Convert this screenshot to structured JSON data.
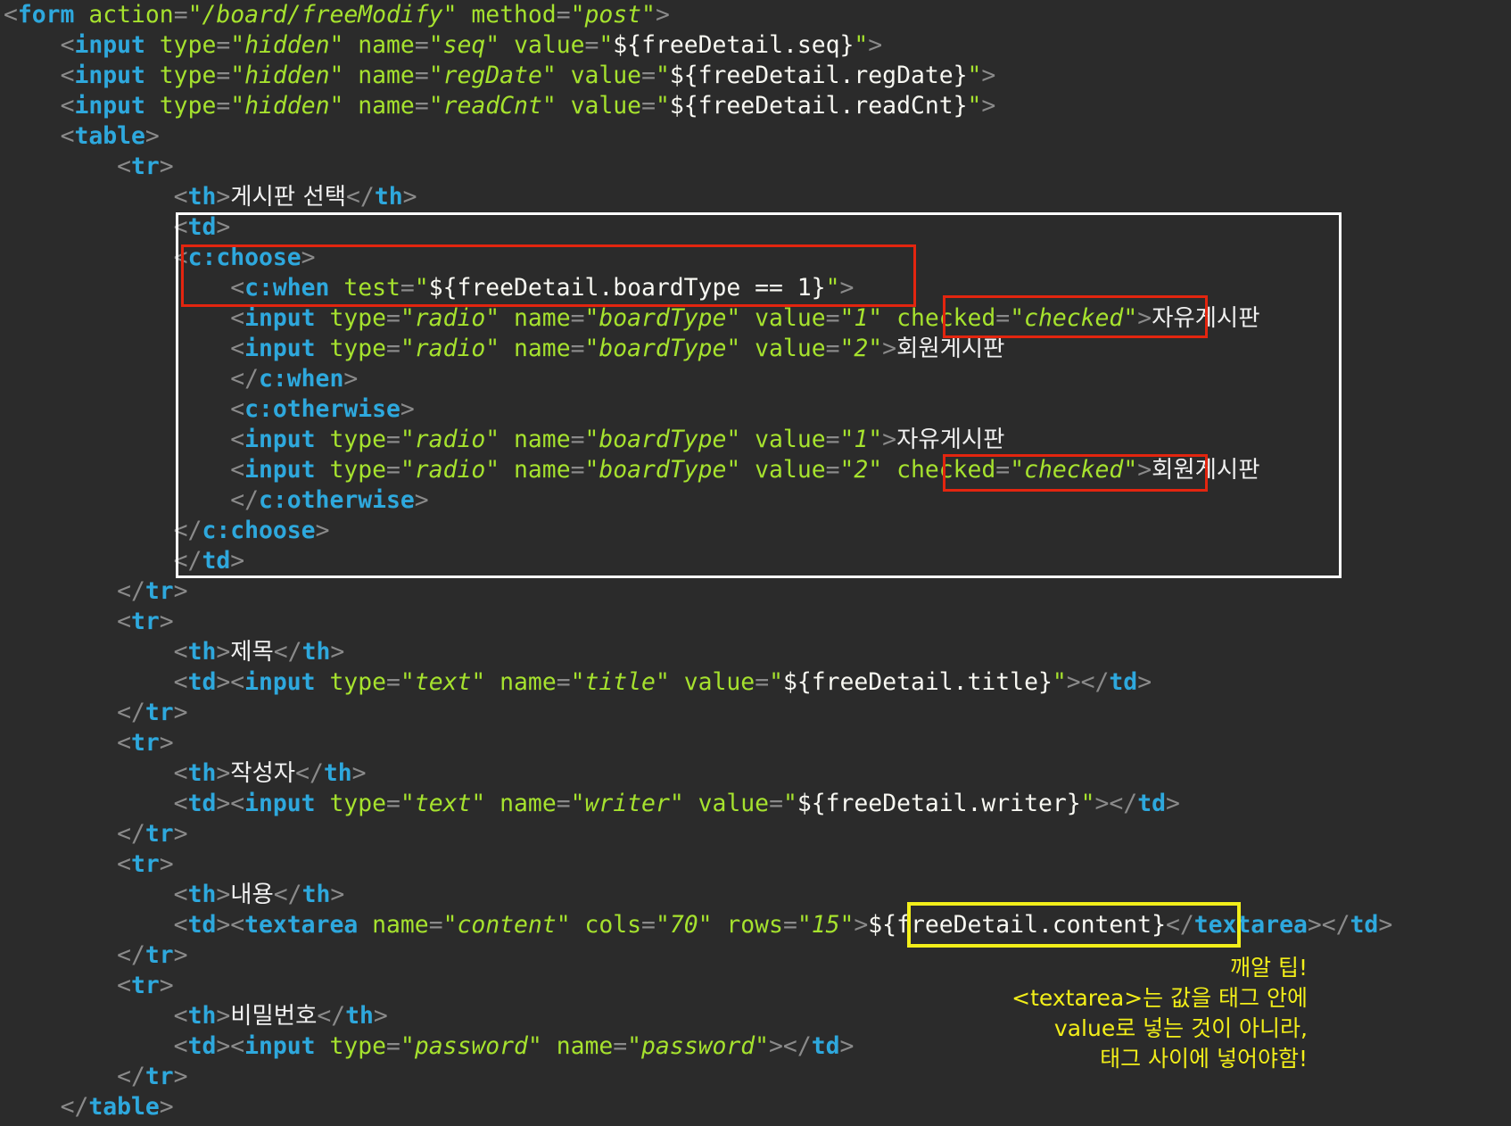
{
  "code_lines": [
    [
      [
        "pun",
        "<"
      ],
      [
        "tag",
        "form"
      ],
      [
        "sp",
        " "
      ],
      [
        "attr",
        "action"
      ],
      [
        "pun",
        "="
      ],
      [
        "q",
        "\""
      ],
      [
        "str",
        "/board/freeModify"
      ],
      [
        "q",
        "\""
      ],
      [
        "sp",
        " "
      ],
      [
        "attr",
        "method"
      ],
      [
        "pun",
        "="
      ],
      [
        "q",
        "\""
      ],
      [
        "str",
        "post"
      ],
      [
        "q",
        "\""
      ],
      [
        "pun",
        ">"
      ]
    ],
    [
      [
        "sp",
        "    "
      ],
      [
        "pun",
        "<"
      ],
      [
        "tag",
        "input"
      ],
      [
        "sp",
        " "
      ],
      [
        "attr",
        "type"
      ],
      [
        "pun",
        "="
      ],
      [
        "q",
        "\""
      ],
      [
        "str",
        "hidden"
      ],
      [
        "q",
        "\""
      ],
      [
        "sp",
        " "
      ],
      [
        "attr",
        "name"
      ],
      [
        "pun",
        "="
      ],
      [
        "q",
        "\""
      ],
      [
        "str",
        "seq"
      ],
      [
        "q",
        "\""
      ],
      [
        "sp",
        " "
      ],
      [
        "attr",
        "value"
      ],
      [
        "pun",
        "="
      ],
      [
        "q",
        "\""
      ],
      [
        "el",
        "${freeDetail.seq}"
      ],
      [
        "q",
        "\""
      ],
      [
        "pun",
        ">"
      ]
    ],
    [
      [
        "sp",
        "    "
      ],
      [
        "pun",
        "<"
      ],
      [
        "tag",
        "input"
      ],
      [
        "sp",
        " "
      ],
      [
        "attr",
        "type"
      ],
      [
        "pun",
        "="
      ],
      [
        "q",
        "\""
      ],
      [
        "str",
        "hidden"
      ],
      [
        "q",
        "\""
      ],
      [
        "sp",
        " "
      ],
      [
        "attr",
        "name"
      ],
      [
        "pun",
        "="
      ],
      [
        "q",
        "\""
      ],
      [
        "str",
        "regDate"
      ],
      [
        "q",
        "\""
      ],
      [
        "sp",
        " "
      ],
      [
        "attr",
        "value"
      ],
      [
        "pun",
        "="
      ],
      [
        "q",
        "\""
      ],
      [
        "el",
        "${freeDetail.regDate}"
      ],
      [
        "q",
        "\""
      ],
      [
        "pun",
        ">"
      ]
    ],
    [
      [
        "sp",
        "    "
      ],
      [
        "pun",
        "<"
      ],
      [
        "tag",
        "input"
      ],
      [
        "sp",
        " "
      ],
      [
        "attr",
        "type"
      ],
      [
        "pun",
        "="
      ],
      [
        "q",
        "\""
      ],
      [
        "str",
        "hidden"
      ],
      [
        "q",
        "\""
      ],
      [
        "sp",
        " "
      ],
      [
        "attr",
        "name"
      ],
      [
        "pun",
        "="
      ],
      [
        "q",
        "\""
      ],
      [
        "str",
        "readCnt"
      ],
      [
        "q",
        "\""
      ],
      [
        "sp",
        " "
      ],
      [
        "attr",
        "value"
      ],
      [
        "pun",
        "="
      ],
      [
        "q",
        "\""
      ],
      [
        "el",
        "${freeDetail.readCnt}"
      ],
      [
        "q",
        "\""
      ],
      [
        "pun",
        ">"
      ]
    ],
    [
      [
        "sp",
        "    "
      ],
      [
        "pun",
        "<"
      ],
      [
        "tag",
        "table"
      ],
      [
        "pun",
        ">"
      ]
    ],
    [
      [
        "sp",
        "        "
      ],
      [
        "pun",
        "<"
      ],
      [
        "tag",
        "tr"
      ],
      [
        "pun",
        ">"
      ]
    ],
    [
      [
        "sp",
        "            "
      ],
      [
        "pun",
        "<"
      ],
      [
        "tag",
        "th"
      ],
      [
        "pun",
        ">"
      ],
      [
        "ko",
        "게시판 선택"
      ],
      [
        "pun",
        "</"
      ],
      [
        "tag",
        "th"
      ],
      [
        "pun",
        ">"
      ]
    ],
    [
      [
        "sp",
        "            "
      ],
      [
        "pun",
        "<"
      ],
      [
        "tag",
        "td"
      ],
      [
        "pun",
        ">"
      ]
    ],
    [
      [
        "sp",
        "            "
      ],
      [
        "pun",
        "<"
      ],
      [
        "tag",
        "c:choose"
      ],
      [
        "pun",
        ">"
      ]
    ],
    [
      [
        "sp",
        "                "
      ],
      [
        "pun",
        "<"
      ],
      [
        "tag",
        "c:when"
      ],
      [
        "sp",
        " "
      ],
      [
        "attr",
        "test"
      ],
      [
        "pun",
        "="
      ],
      [
        "q",
        "\""
      ],
      [
        "el",
        "${freeDetail.boardType == 1}"
      ],
      [
        "q",
        "\""
      ],
      [
        "pun",
        ">"
      ]
    ],
    [
      [
        "sp",
        "                "
      ],
      [
        "pun",
        "<"
      ],
      [
        "tag",
        "input"
      ],
      [
        "sp",
        " "
      ],
      [
        "attr",
        "type"
      ],
      [
        "pun",
        "="
      ],
      [
        "q",
        "\""
      ],
      [
        "str",
        "radio"
      ],
      [
        "q",
        "\""
      ],
      [
        "sp",
        " "
      ],
      [
        "attr",
        "name"
      ],
      [
        "pun",
        "="
      ],
      [
        "q",
        "\""
      ],
      [
        "str",
        "boardType"
      ],
      [
        "q",
        "\""
      ],
      [
        "sp",
        " "
      ],
      [
        "attr",
        "value"
      ],
      [
        "pun",
        "="
      ],
      [
        "q",
        "\""
      ],
      [
        "str",
        "1"
      ],
      [
        "q",
        "\""
      ],
      [
        "sp",
        " "
      ],
      [
        "attr",
        "checked"
      ],
      [
        "pun",
        "="
      ],
      [
        "q",
        "\""
      ],
      [
        "str",
        "checked"
      ],
      [
        "q",
        "\""
      ],
      [
        "pun",
        ">"
      ],
      [
        "ko",
        "자유게시판"
      ]
    ],
    [
      [
        "sp",
        "                "
      ],
      [
        "pun",
        "<"
      ],
      [
        "tag",
        "input"
      ],
      [
        "sp",
        " "
      ],
      [
        "attr",
        "type"
      ],
      [
        "pun",
        "="
      ],
      [
        "q",
        "\""
      ],
      [
        "str",
        "radio"
      ],
      [
        "q",
        "\""
      ],
      [
        "sp",
        " "
      ],
      [
        "attr",
        "name"
      ],
      [
        "pun",
        "="
      ],
      [
        "q",
        "\""
      ],
      [
        "str",
        "boardType"
      ],
      [
        "q",
        "\""
      ],
      [
        "sp",
        " "
      ],
      [
        "attr",
        "value"
      ],
      [
        "pun",
        "="
      ],
      [
        "q",
        "\""
      ],
      [
        "str",
        "2"
      ],
      [
        "q",
        "\""
      ],
      [
        "pun",
        ">"
      ],
      [
        "ko",
        "회원게시판"
      ]
    ],
    [
      [
        "sp",
        "                "
      ],
      [
        "pun",
        "</"
      ],
      [
        "tag",
        "c:when"
      ],
      [
        "pun",
        ">"
      ]
    ],
    [
      [
        "sp",
        "                "
      ],
      [
        "pun",
        "<"
      ],
      [
        "tag",
        "c:otherwise"
      ],
      [
        "pun",
        ">"
      ]
    ],
    [
      [
        "sp",
        "                "
      ],
      [
        "pun",
        "<"
      ],
      [
        "tag",
        "input"
      ],
      [
        "sp",
        " "
      ],
      [
        "attr",
        "type"
      ],
      [
        "pun",
        "="
      ],
      [
        "q",
        "\""
      ],
      [
        "str",
        "radio"
      ],
      [
        "q",
        "\""
      ],
      [
        "sp",
        " "
      ],
      [
        "attr",
        "name"
      ],
      [
        "pun",
        "="
      ],
      [
        "q",
        "\""
      ],
      [
        "str",
        "boardType"
      ],
      [
        "q",
        "\""
      ],
      [
        "sp",
        " "
      ],
      [
        "attr",
        "value"
      ],
      [
        "pun",
        "="
      ],
      [
        "q",
        "\""
      ],
      [
        "str",
        "1"
      ],
      [
        "q",
        "\""
      ],
      [
        "pun",
        ">"
      ],
      [
        "ko",
        "자유게시판"
      ]
    ],
    [
      [
        "sp",
        "                "
      ],
      [
        "pun",
        "<"
      ],
      [
        "tag",
        "input"
      ],
      [
        "sp",
        " "
      ],
      [
        "attr",
        "type"
      ],
      [
        "pun",
        "="
      ],
      [
        "q",
        "\""
      ],
      [
        "str",
        "radio"
      ],
      [
        "q",
        "\""
      ],
      [
        "sp",
        " "
      ],
      [
        "attr",
        "name"
      ],
      [
        "pun",
        "="
      ],
      [
        "q",
        "\""
      ],
      [
        "str",
        "boardType"
      ],
      [
        "q",
        "\""
      ],
      [
        "sp",
        " "
      ],
      [
        "attr",
        "value"
      ],
      [
        "pun",
        "="
      ],
      [
        "q",
        "\""
      ],
      [
        "str",
        "2"
      ],
      [
        "q",
        "\""
      ],
      [
        "sp",
        " "
      ],
      [
        "attr",
        "checked"
      ],
      [
        "pun",
        "="
      ],
      [
        "q",
        "\""
      ],
      [
        "str",
        "checked"
      ],
      [
        "q",
        "\""
      ],
      [
        "pun",
        ">"
      ],
      [
        "ko",
        "회원게시판"
      ]
    ],
    [
      [
        "sp",
        "                "
      ],
      [
        "pun",
        "</"
      ],
      [
        "tag",
        "c:otherwise"
      ],
      [
        "pun",
        ">"
      ]
    ],
    [
      [
        "sp",
        "            "
      ],
      [
        "pun",
        "</"
      ],
      [
        "tag",
        "c:choose"
      ],
      [
        "pun",
        ">"
      ]
    ],
    [
      [
        "sp",
        "            "
      ],
      [
        "pun",
        "</"
      ],
      [
        "tag",
        "td"
      ],
      [
        "pun",
        ">"
      ]
    ],
    [
      [
        "sp",
        "        "
      ],
      [
        "pun",
        "</"
      ],
      [
        "tag",
        "tr"
      ],
      [
        "pun",
        ">"
      ]
    ],
    [
      [
        "sp",
        "        "
      ],
      [
        "pun",
        "<"
      ],
      [
        "tag",
        "tr"
      ],
      [
        "pun",
        ">"
      ]
    ],
    [
      [
        "sp",
        "            "
      ],
      [
        "pun",
        "<"
      ],
      [
        "tag",
        "th"
      ],
      [
        "pun",
        ">"
      ],
      [
        "ko",
        "제목"
      ],
      [
        "pun",
        "</"
      ],
      [
        "tag",
        "th"
      ],
      [
        "pun",
        ">"
      ]
    ],
    [
      [
        "sp",
        "            "
      ],
      [
        "pun",
        "<"
      ],
      [
        "tag",
        "td"
      ],
      [
        "pun",
        "><"
      ],
      [
        "tag",
        "input"
      ],
      [
        "sp",
        " "
      ],
      [
        "attr",
        "type"
      ],
      [
        "pun",
        "="
      ],
      [
        "q",
        "\""
      ],
      [
        "str",
        "text"
      ],
      [
        "q",
        "\""
      ],
      [
        "sp",
        " "
      ],
      [
        "attr",
        "name"
      ],
      [
        "pun",
        "="
      ],
      [
        "q",
        "\""
      ],
      [
        "str",
        "title"
      ],
      [
        "q",
        "\""
      ],
      [
        "sp",
        " "
      ],
      [
        "attr",
        "value"
      ],
      [
        "pun",
        "="
      ],
      [
        "q",
        "\""
      ],
      [
        "el",
        "${freeDetail.title}"
      ],
      [
        "q",
        "\""
      ],
      [
        "pun",
        "></"
      ],
      [
        "tag",
        "td"
      ],
      [
        "pun",
        ">"
      ]
    ],
    [
      [
        "sp",
        "        "
      ],
      [
        "pun",
        "</"
      ],
      [
        "tag",
        "tr"
      ],
      [
        "pun",
        ">"
      ]
    ],
    [
      [
        "sp",
        "        "
      ],
      [
        "pun",
        "<"
      ],
      [
        "tag",
        "tr"
      ],
      [
        "pun",
        ">"
      ]
    ],
    [
      [
        "sp",
        "            "
      ],
      [
        "pun",
        "<"
      ],
      [
        "tag",
        "th"
      ],
      [
        "pun",
        ">"
      ],
      [
        "ko",
        "작성자"
      ],
      [
        "pun",
        "</"
      ],
      [
        "tag",
        "th"
      ],
      [
        "pun",
        ">"
      ]
    ],
    [
      [
        "sp",
        "            "
      ],
      [
        "pun",
        "<"
      ],
      [
        "tag",
        "td"
      ],
      [
        "pun",
        "><"
      ],
      [
        "tag",
        "input"
      ],
      [
        "sp",
        " "
      ],
      [
        "attr",
        "type"
      ],
      [
        "pun",
        "="
      ],
      [
        "q",
        "\""
      ],
      [
        "str",
        "text"
      ],
      [
        "q",
        "\""
      ],
      [
        "sp",
        " "
      ],
      [
        "attr",
        "name"
      ],
      [
        "pun",
        "="
      ],
      [
        "q",
        "\""
      ],
      [
        "str",
        "writer"
      ],
      [
        "q",
        "\""
      ],
      [
        "sp",
        " "
      ],
      [
        "attr",
        "value"
      ],
      [
        "pun",
        "="
      ],
      [
        "q",
        "\""
      ],
      [
        "el",
        "${freeDetail.writer}"
      ],
      [
        "q",
        "\""
      ],
      [
        "pun",
        "></"
      ],
      [
        "tag",
        "td"
      ],
      [
        "pun",
        ">"
      ]
    ],
    [
      [
        "sp",
        "        "
      ],
      [
        "pun",
        "</"
      ],
      [
        "tag",
        "tr"
      ],
      [
        "pun",
        ">"
      ]
    ],
    [
      [
        "sp",
        "        "
      ],
      [
        "pun",
        "<"
      ],
      [
        "tag",
        "tr"
      ],
      [
        "pun",
        ">"
      ]
    ],
    [
      [
        "sp",
        "            "
      ],
      [
        "pun",
        "<"
      ],
      [
        "tag",
        "th"
      ],
      [
        "pun",
        ">"
      ],
      [
        "ko",
        "내용"
      ],
      [
        "pun",
        "</"
      ],
      [
        "tag",
        "th"
      ],
      [
        "pun",
        ">"
      ]
    ],
    [
      [
        "sp",
        "            "
      ],
      [
        "pun",
        "<"
      ],
      [
        "tag",
        "td"
      ],
      [
        "pun",
        "><"
      ],
      [
        "tag",
        "textarea"
      ],
      [
        "sp",
        " "
      ],
      [
        "attr",
        "name"
      ],
      [
        "pun",
        "="
      ],
      [
        "q",
        "\""
      ],
      [
        "str",
        "content"
      ],
      [
        "q",
        "\""
      ],
      [
        "sp",
        " "
      ],
      [
        "attr",
        "cols"
      ],
      [
        "pun",
        "="
      ],
      [
        "q",
        "\""
      ],
      [
        "str",
        "70"
      ],
      [
        "q",
        "\""
      ],
      [
        "sp",
        " "
      ],
      [
        "attr",
        "rows"
      ],
      [
        "pun",
        "="
      ],
      [
        "q",
        "\""
      ],
      [
        "str",
        "15"
      ],
      [
        "q",
        "\""
      ],
      [
        "pun",
        ">"
      ],
      [
        "el",
        "${freeDetail.content}"
      ],
      [
        "pun",
        "</"
      ],
      [
        "tag",
        "textarea"
      ],
      [
        "pun",
        "></"
      ],
      [
        "tag",
        "td"
      ],
      [
        "pun",
        ">"
      ]
    ],
    [
      [
        "sp",
        "        "
      ],
      [
        "pun",
        "</"
      ],
      [
        "tag",
        "tr"
      ],
      [
        "pun",
        ">"
      ]
    ],
    [
      [
        "sp",
        "        "
      ],
      [
        "pun",
        "<"
      ],
      [
        "tag",
        "tr"
      ],
      [
        "pun",
        ">"
      ]
    ],
    [
      [
        "sp",
        "            "
      ],
      [
        "pun",
        "<"
      ],
      [
        "tag",
        "th"
      ],
      [
        "pun",
        ">"
      ],
      [
        "ko",
        "비밀번호"
      ],
      [
        "pun",
        "</"
      ],
      [
        "tag",
        "th"
      ],
      [
        "pun",
        ">"
      ]
    ],
    [
      [
        "sp",
        "            "
      ],
      [
        "pun",
        "<"
      ],
      [
        "tag",
        "td"
      ],
      [
        "pun",
        "><"
      ],
      [
        "tag",
        "input"
      ],
      [
        "sp",
        " "
      ],
      [
        "attr",
        "type"
      ],
      [
        "pun",
        "="
      ],
      [
        "q",
        "\""
      ],
      [
        "str",
        "password"
      ],
      [
        "q",
        "\""
      ],
      [
        "sp",
        " "
      ],
      [
        "attr",
        "name"
      ],
      [
        "pun",
        "="
      ],
      [
        "q",
        "\""
      ],
      [
        "str",
        "password"
      ],
      [
        "q",
        "\""
      ],
      [
        "pun",
        "></"
      ],
      [
        "tag",
        "td"
      ],
      [
        "pun",
        ">"
      ]
    ],
    [
      [
        "sp",
        "        "
      ],
      [
        "pun",
        "</"
      ],
      [
        "tag",
        "tr"
      ],
      [
        "pun",
        ">"
      ]
    ],
    [
      [
        "sp",
        "    "
      ],
      [
        "pun",
        "</"
      ],
      [
        "tag",
        "table"
      ],
      [
        "pun",
        ">"
      ]
    ]
  ],
  "tip": {
    "line1": "깨알 팁!",
    "line2": "<textarea>는 값을 태그 안에",
    "line3": "value로 넣는 것이 아니라,",
    "line4": "태그 사이에 넣어야함!"
  },
  "colors": {
    "background": "#2b2b2b",
    "tag": "#2ea8dd",
    "attribute": "#a6e22e",
    "highlight_red": "#e3250f",
    "highlight_white": "#ffffff",
    "highlight_yellow": "#f2ee1a"
  }
}
